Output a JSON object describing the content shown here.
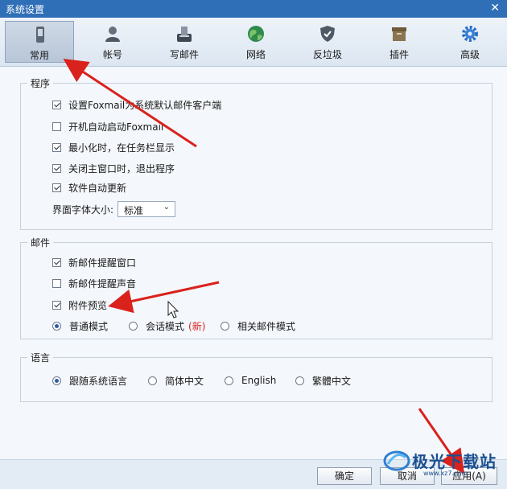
{
  "window": {
    "title": "系统设置",
    "close_glyph": "✕"
  },
  "toolbar": {
    "items": [
      {
        "label": "常用",
        "icon": "phone-icon"
      },
      {
        "label": "帐号",
        "icon": "user-icon"
      },
      {
        "label": "写邮件",
        "icon": "compose-icon"
      },
      {
        "label": "网络",
        "icon": "globe-icon"
      },
      {
        "label": "反垃圾",
        "icon": "shield-icon"
      },
      {
        "label": "插件",
        "icon": "plugin-box-icon"
      },
      {
        "label": "高级",
        "icon": "gear-icon"
      }
    ],
    "active": "常用"
  },
  "program": {
    "legend": "程序",
    "options": [
      {
        "label": "设置Foxmail为系统默认邮件客户端",
        "checked": true
      },
      {
        "label": "开机自动启动Foxmail",
        "checked": false
      },
      {
        "label": "最小化时，在任务栏显示",
        "checked": true
      },
      {
        "label": "关闭主窗口时，退出程序",
        "checked": true
      },
      {
        "label": "软件自动更新",
        "checked": true
      }
    ],
    "font_size_label": "界面字体大小:",
    "font_size_value": "标准",
    "dropdown_glyph": "⌄"
  },
  "mail": {
    "legend": "邮件",
    "options": [
      {
        "label": "新邮件提醒窗口",
        "checked": true
      },
      {
        "label": "新邮件提醒声音",
        "checked": false
      },
      {
        "label": "附件预览",
        "checked": true
      }
    ],
    "modes": [
      {
        "label": "普通模式",
        "selected": true
      },
      {
        "label": "会话模式",
        "selected": false,
        "badge": "(新)"
      },
      {
        "label": "相关邮件模式",
        "selected": false
      }
    ]
  },
  "language": {
    "legend": "语言",
    "options": [
      {
        "label": "跟随系统语言",
        "selected": true
      },
      {
        "label": "简体中文",
        "selected": false
      },
      {
        "label": "English",
        "selected": false
      },
      {
        "label": "繁體中文",
        "selected": false
      }
    ]
  },
  "footer": {
    "ok": "确定",
    "cancel": "取消",
    "apply": "应用(A)"
  },
  "watermark": {
    "text": "极光下载站",
    "sub": "www.xz7.com"
  },
  "colors": {
    "titlebar": "#2f6fb7",
    "annotation_arrow": "#d9221c",
    "selected_radio": "#2a5fa8"
  }
}
